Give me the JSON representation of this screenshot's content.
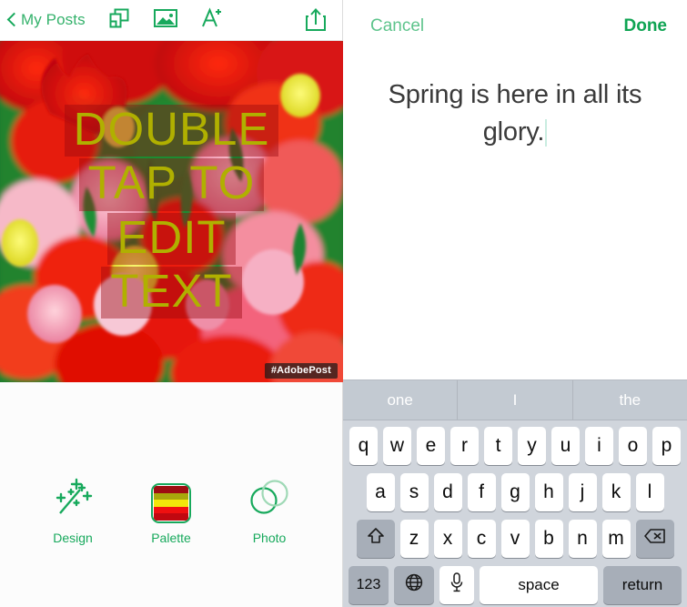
{
  "editor": {
    "back_label": "My Posts",
    "icons": {
      "back": "chevron-left-icon",
      "duplicate": "duplicate-layers-icon",
      "image": "image-icon",
      "add_text": "add-text-icon",
      "share": "share-icon"
    },
    "canvas": {
      "text_lines": [
        "DOUBLE",
        "TAP TO",
        "EDIT",
        "TEXT"
      ],
      "watermark": "#AdobePost",
      "text_color": "#b0b000",
      "overlay_color": "rgba(150,8,14,0.42)"
    },
    "tools": [
      {
        "label": "Design",
        "icon": "magic-wand-icon"
      },
      {
        "label": "Palette",
        "icon": "palette-icon",
        "swatches": [
          "#9e0d12",
          "#a8a80c",
          "#f2e60a",
          "#f01010",
          "#c10810"
        ]
      },
      {
        "label": "Photo",
        "icon": "photo-circles-icon"
      }
    ],
    "accent_color": "#17a95c"
  },
  "text_editor": {
    "cancel_label": "Cancel",
    "done_label": "Done",
    "value": "Spring is here in all its glory.",
    "cancel_color": "#5ec48c",
    "done_color": "#0fa453"
  },
  "keyboard": {
    "suggestions": [
      "one",
      "I",
      "the"
    ],
    "row1": [
      "q",
      "w",
      "e",
      "r",
      "t",
      "y",
      "u",
      "i",
      "o",
      "p"
    ],
    "row2": [
      "a",
      "s",
      "d",
      "f",
      "g",
      "h",
      "j",
      "k",
      "l"
    ],
    "row3": [
      "z",
      "x",
      "c",
      "v",
      "b",
      "n",
      "m"
    ],
    "shift_icon": "shift-arrow-icon",
    "backspace_icon": "backspace-icon",
    "numbers_label": "123",
    "globe_icon": "globe-icon",
    "mic_icon": "microphone-icon",
    "space_label": "space",
    "return_label": "return"
  }
}
